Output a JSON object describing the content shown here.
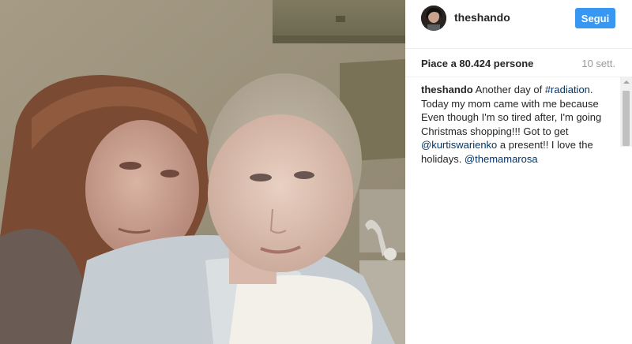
{
  "photo": {
    "alt_icon": "selfie-photo"
  },
  "header": {
    "username": "theshando",
    "follow_label": "Segui"
  },
  "meta": {
    "likes": "Piace a 80.424 persone",
    "timestamp": "10 sett."
  },
  "caption": {
    "username": "theshando",
    "text_1": " Another day of ",
    "hashtag": "#radiation",
    "text_2": ". Today my mom came with me because Even though I'm so tired after, I'm going Christmas shopping!!! Got to get ",
    "mention_1": "@kurtiswarienko",
    "text_3": " a present!! I love the holidays. ",
    "mention_2": "@themamarosa"
  },
  "colors": {
    "follow_button": "#3897f0",
    "link": "#003569",
    "muted": "#999999"
  }
}
